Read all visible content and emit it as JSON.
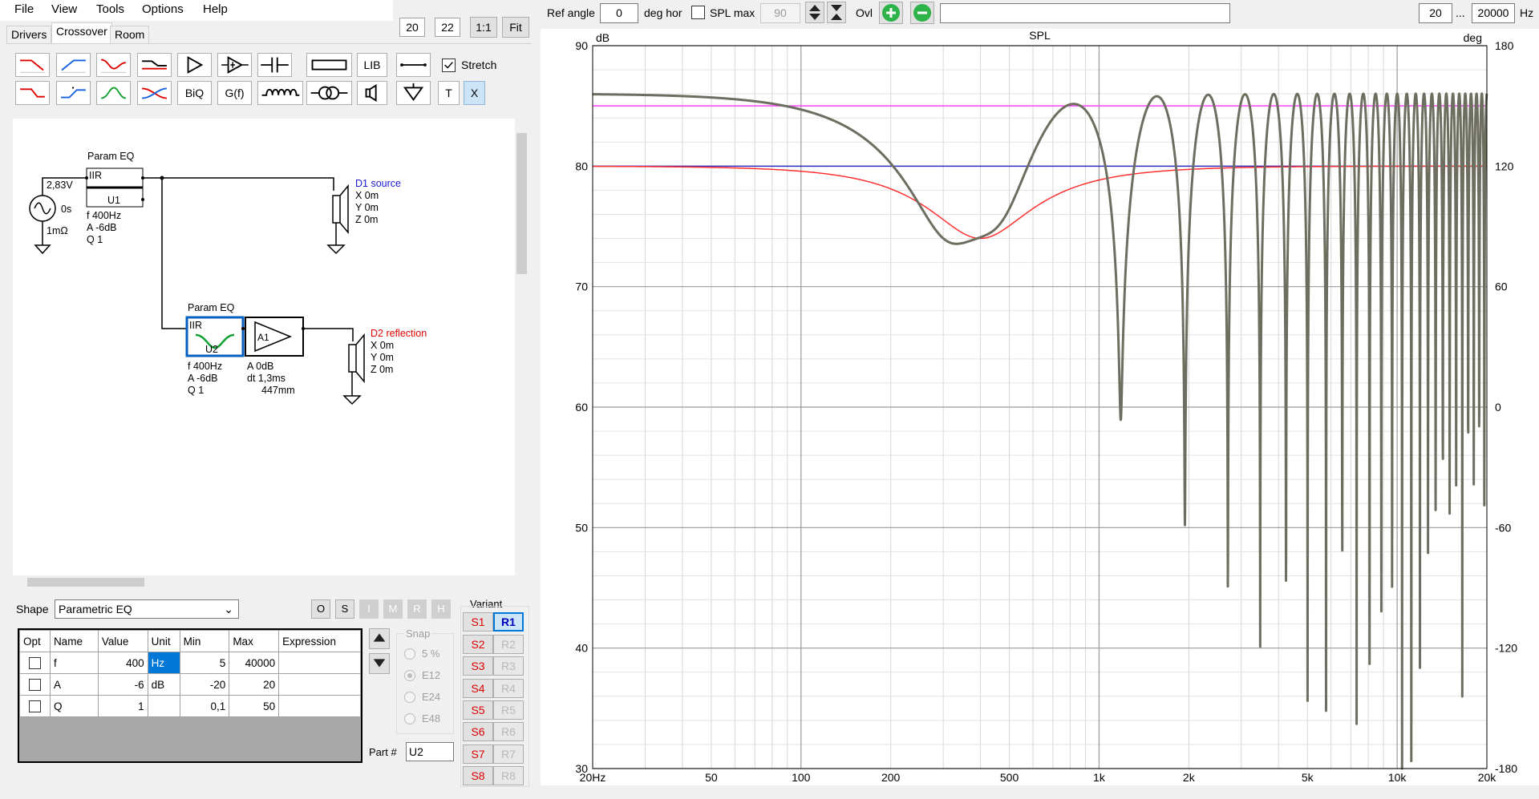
{
  "menu": {
    "items": [
      "File",
      "View",
      "Tools",
      "Options",
      "Help"
    ]
  },
  "left_toolbar": {
    "value_a": "20",
    "value_b": "22",
    "one_to_one": "1:1",
    "fit": "Fit"
  },
  "tabs": [
    "Drivers",
    "Crossover",
    "Room"
  ],
  "palette": {
    "lib": "LIB",
    "stretch_label": "Stretch",
    "biq": "BiQ",
    "gf": "G(f)",
    "t": "T",
    "x": "X",
    "icons": [
      "lowpass-red-icon",
      "highpass-blue-icon",
      "bandpass-red-icon",
      "shelf-icon",
      "amplifier-icon",
      "buffer-icon",
      "capacitor-icon",
      "resistor-icon",
      "lowpass-shelf-icon",
      "highpass-shelf-icon",
      "peak-green-icon",
      "crossover-icon",
      "inductor-icon",
      "transformer-icon",
      "speaker-icon",
      "ground-icon",
      "wire-icon"
    ]
  },
  "schematic": {
    "eq1": {
      "title": "Param EQ",
      "type": "IIR",
      "part": "U1",
      "f": "f   400Hz",
      "a": "A  -6dB",
      "q": "Q  1"
    },
    "source": {
      "voltage": "2,83V",
      "delay": "0s",
      "impedance": "1mΩ"
    },
    "d1": {
      "name": "D1 source",
      "x": "X 0m",
      "y": "Y 0m",
      "z": "Z 0m"
    },
    "eq2": {
      "title": "Param EQ",
      "type": "IIR",
      "part": "U2",
      "f": "f   400Hz",
      "a": "A  -6dB",
      "q": "Q  1"
    },
    "amp": {
      "part": "A1",
      "a": "A  0dB",
      "dt": "dt 1,3ms",
      "mm": "447mm"
    },
    "d2": {
      "name": "D2 reflection",
      "x": "X 0m",
      "y": "Y 0m",
      "z": "Z 0m"
    }
  },
  "props": {
    "shape_label": "Shape",
    "shape_value": "Parametric EQ",
    "buttons": [
      "O",
      "S",
      "I",
      "M",
      "R",
      "H"
    ],
    "columns": [
      "Opt",
      "Name",
      "Value",
      "Unit",
      "Min",
      "Max",
      "Expression"
    ],
    "rows": [
      {
        "name": "f",
        "value": "400",
        "unit": "Hz",
        "min": "5",
        "max": "40000",
        "expr": ""
      },
      {
        "name": "A",
        "value": "-6",
        "unit": "dB",
        "min": "-20",
        "max": "20",
        "expr": ""
      },
      {
        "name": "Q",
        "value": "1",
        "unit": "",
        "min": "0,1",
        "max": "50",
        "expr": ""
      }
    ],
    "snap_label": "Snap",
    "snap_options": [
      "5 %",
      "E12",
      "E24",
      "E48"
    ],
    "part_label": "Part #",
    "part_value": "U2",
    "variant_label": "Variant",
    "variant_s": [
      "S1",
      "S2",
      "S3",
      "S4",
      "S5",
      "S6",
      "S7",
      "S8"
    ],
    "variant_r": [
      "R1",
      "R2",
      "R3",
      "R4",
      "R5",
      "R6",
      "R7",
      "R8"
    ]
  },
  "right_toolbar": {
    "ref_angle_label": "Ref angle",
    "ref_angle_value": "0",
    "deg_hor": "deg hor",
    "spl_max_label": "SPL max",
    "spl_max_value": "90",
    "ovl": "Ovl",
    "freq_min": "20",
    "ellipsis": "...",
    "freq_max": "20000",
    "hz": "Hz"
  },
  "colors": {
    "total_response": "#6e6e60",
    "reflection": "#ff3030",
    "reference_magenta": "#ff40ff",
    "reference_blue": "#3030c0",
    "selected_blue": "#0060c0",
    "green_add": "#2db34a"
  },
  "chart_data": {
    "type": "line",
    "title": "SPL",
    "ylabel": "dB",
    "y2label": "deg",
    "xscale": "log",
    "xlim": [
      20,
      20000
    ],
    "ylim": [
      30,
      90
    ],
    "y2lim": [
      -180,
      180
    ],
    "xticks": [
      {
        "v": 20,
        "label": "20Hz"
      },
      {
        "v": 50,
        "label": "50"
      },
      {
        "v": 100,
        "label": "100"
      },
      {
        "v": 200,
        "label": "200"
      },
      {
        "v": 500,
        "label": "500"
      },
      {
        "v": 1000,
        "label": "1k"
      },
      {
        "v": 2000,
        "label": "2k"
      },
      {
        "v": 5000,
        "label": "5k"
      },
      {
        "v": 10000,
        "label": "10k"
      },
      {
        "v": 20000,
        "label": "20k"
      }
    ],
    "yticks": [
      30,
      40,
      50,
      60,
      70,
      80,
      90
    ],
    "y2ticks": [
      -180,
      -120,
      -60,
      0,
      60,
      120,
      180
    ],
    "series": [
      {
        "color": "magenta",
        "constant_db": 85
      },
      {
        "color": "blue",
        "constant_db": 80
      },
      {
        "color": "red",
        "eq_center_hz": 400,
        "eq_gain_db": -6,
        "eq_q": 1,
        "base_db": 80
      },
      {
        "color": "gray",
        "base_db": 80,
        "reflection_delay_ms": 1.3,
        "reflection_eq_center_hz": 400,
        "reflection_eq_gain_db": -6
      }
    ],
    "grid": true
  }
}
